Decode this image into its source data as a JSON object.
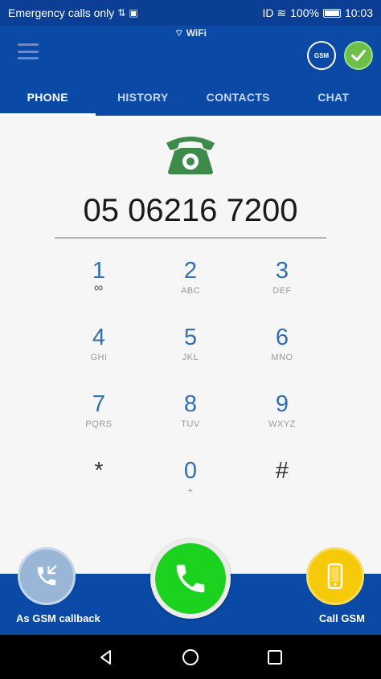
{
  "status_bar": {
    "carrier_text": "Emergency calls only",
    "extra_icons": "ID ≋",
    "battery": "100%",
    "time": "10:03"
  },
  "app_bar": {
    "network_label": "WiFi",
    "badge_text": "GSM"
  },
  "tabs": [
    {
      "label": "PHONE",
      "active": true
    },
    {
      "label": "HISTORY",
      "active": false
    },
    {
      "label": "CONTACTS",
      "active": false
    },
    {
      "label": "CHAT",
      "active": false
    }
  ],
  "dialer": {
    "number": "05 06216 7200",
    "phone_graphic_color": "#3d8a4a",
    "keys": [
      {
        "main": "1",
        "sub": "∞"
      },
      {
        "main": "2",
        "sub": "ABC"
      },
      {
        "main": "3",
        "sub": "DEF"
      },
      {
        "main": "4",
        "sub": "GHI"
      },
      {
        "main": "5",
        "sub": "JKL"
      },
      {
        "main": "6",
        "sub": "MNO"
      },
      {
        "main": "7",
        "sub": "PQRS"
      },
      {
        "main": "8",
        "sub": "TUV"
      },
      {
        "main": "9",
        "sub": "WXYZ"
      },
      {
        "main": "*",
        "sub": ""
      },
      {
        "main": "0",
        "sub": "+"
      },
      {
        "main": "#",
        "sub": ""
      }
    ]
  },
  "actions": {
    "callback_label": "As GSM callback",
    "gsm_label": "Call GSM",
    "call_color": "#1bd21e",
    "gsm_color": "#f7c90b"
  },
  "colors": {
    "brand_blue": "#0a4aa6",
    "status_blue": "#0a3f95"
  }
}
